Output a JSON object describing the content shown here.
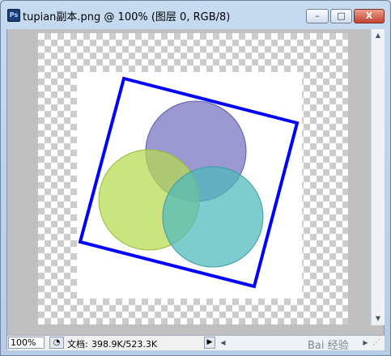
{
  "window": {
    "title": "tupian副本.png @ 100% (图层 0, RGB/8)",
    "app_icon": "photoshop-icon",
    "minimize_label": "–",
    "maximize_label": "□",
    "close_label": "X"
  },
  "canvas": {
    "background": "transparency-checkerboard",
    "frame_color": "#0000ff",
    "circles": [
      {
        "name": "purple-circle",
        "color": "#7472c0"
      },
      {
        "name": "green-circle",
        "color": "#b6d94f"
      },
      {
        "name": "teal-circle",
        "color": "#4db8bd"
      }
    ]
  },
  "statusbar": {
    "zoom": "100%",
    "doc_label": "文档:",
    "doc_size": "398.9K/523.3K",
    "watermark": "Bai 经验"
  },
  "icons": {
    "scroll_up": "▲",
    "scroll_down": "▼",
    "scroll_left": "◀",
    "scroll_right": "▶",
    "status_menu": "▶",
    "status_info": "◔",
    "grip": "⋰"
  }
}
